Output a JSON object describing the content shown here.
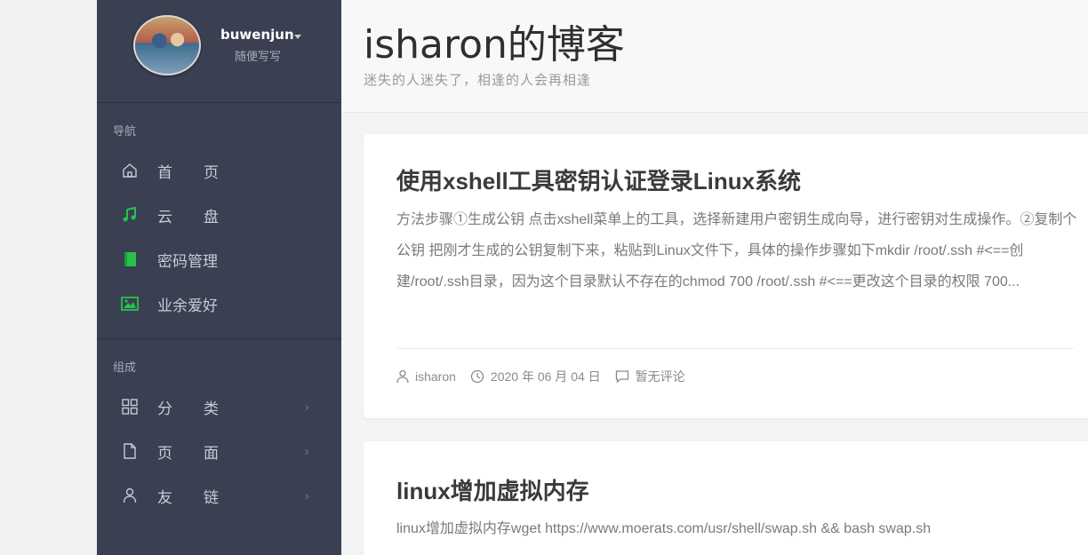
{
  "user": {
    "name": "buwenjun",
    "motto": "随便写写"
  },
  "nav": {
    "section_title": "导航",
    "items": [
      {
        "label": "首页",
        "icon": "home-icon"
      },
      {
        "label": "云盘",
        "icon": "music-note-icon"
      },
      {
        "label": "密码管理",
        "icon": "book-icon"
      },
      {
        "label": "业余爱好",
        "icon": "image-icon"
      }
    ]
  },
  "compose": {
    "section_title": "组成",
    "items": [
      {
        "label": "分类",
        "icon": "grid-icon"
      },
      {
        "label": "页面",
        "icon": "file-icon"
      },
      {
        "label": "友链",
        "icon": "user-icon"
      }
    ]
  },
  "site": {
    "title": "isharon的博客",
    "subtitle": "迷失的人迷失了，相逢的人会再相逢"
  },
  "posts": [
    {
      "title": "使用xshell工具密钥认证登录Linux系统",
      "excerpt": "方法步骤①生成公钥   点击xshell菜单上的工具，选择新建用户密钥生成向导，进行密钥对生成操作。②复制个公钥   把刚才生成的公钥复制下来，粘贴到Linux文件下，具体的操作步骤如下mkdir /root/.ssh     #<==创建/root/.ssh目录，因为这个目录默认不存在的chmod 700 /root/.ssh   #<==更改这个目录的权限  700...",
      "author": "isharon",
      "date": "2020 年 06 月 04 日",
      "comments": "暂无评论"
    },
    {
      "title": "linux增加虚拟内存",
      "excerpt": "linux增加虚拟内存wget https://www.moerats.com/usr/shell/swap.sh && bash swap.sh"
    }
  ],
  "colors": {
    "sidebar_bg": "#3a3f51",
    "accent_green": "#27c24c"
  }
}
